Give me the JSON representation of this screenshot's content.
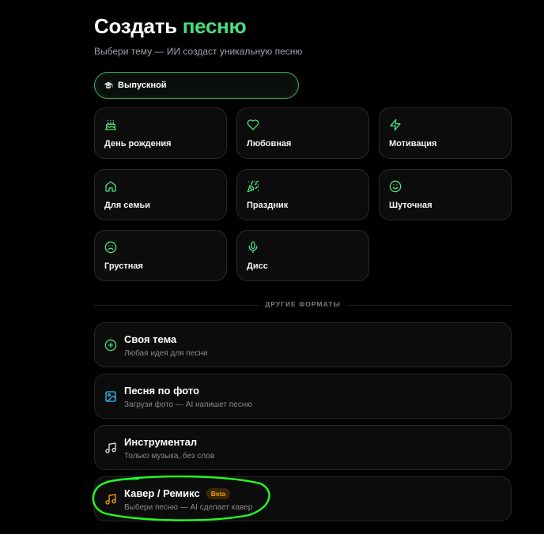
{
  "header": {
    "title_main": "Создать",
    "title_accent": "песню",
    "subtitle": "Выбери тему — ИИ создаст уникальную песню"
  },
  "selected": {
    "icon": "graduation-cap-icon",
    "label": "Выпускной"
  },
  "themes": [
    {
      "label": "День рождения",
      "icon": "cake-icon"
    },
    {
      "label": "Любовная",
      "icon": "heart-icon"
    },
    {
      "label": "Мотивация",
      "icon": "lightning-icon"
    },
    {
      "label": "Для семьи",
      "icon": "home-icon"
    },
    {
      "label": "Праздник",
      "icon": "party-popper-icon"
    },
    {
      "label": "Шуточная",
      "icon": "smile-icon"
    },
    {
      "label": "Грустная",
      "icon": "sad-face-icon"
    },
    {
      "label": "Дисс",
      "icon": "microphone-icon"
    }
  ],
  "other_formats": {
    "heading": "ДРУГИЕ ФОРМАТЫ",
    "items": [
      {
        "title": "Своя тема",
        "subtitle": "Любая идея для песни",
        "icon": "plus-circle-icon",
        "color": "#4ade80"
      },
      {
        "title": "Песня по фото",
        "subtitle": "Загрузи фото — AI напишет песню",
        "icon": "image-icon",
        "color": "#38bdf8"
      },
      {
        "title": "Инструментал",
        "subtitle": "Только музыка, без слов",
        "icon": "music-note-icon",
        "color": "#e5e5e5"
      },
      {
        "title": "Кавер / Ремикс",
        "subtitle": "Выбери песню — AI сделает кавер",
        "icon": "music-note-icon",
        "color": "#f59e0b",
        "badge": "Beta"
      }
    ]
  },
  "colors": {
    "accent": "#4ade80",
    "background": "#000000",
    "card": "#0c0c0c",
    "border": "#2a2a2a",
    "badge": "#f59e0b",
    "annotation": "#22ff22"
  }
}
